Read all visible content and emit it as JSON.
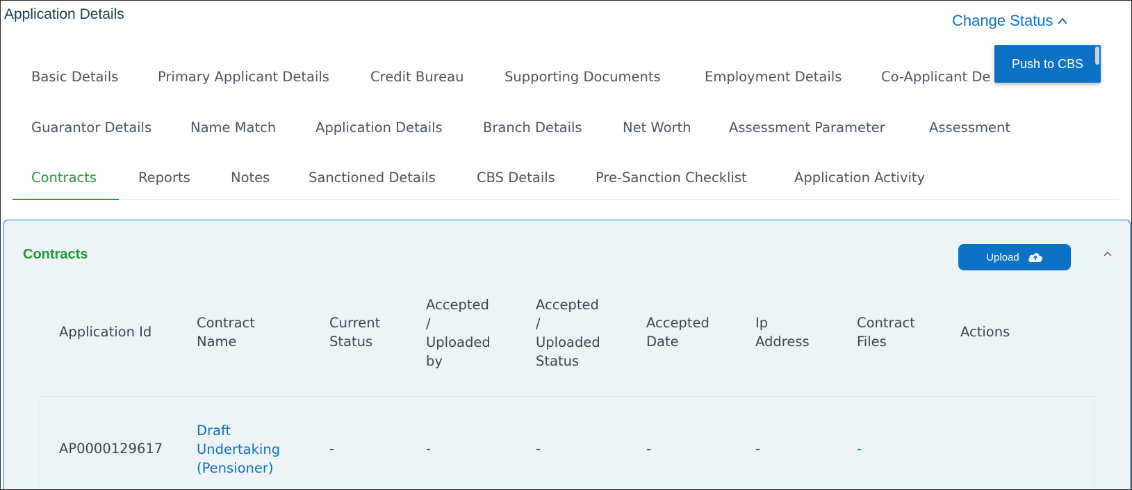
{
  "header": {
    "title": "Application Details",
    "change_status_label": "Change Status",
    "push_to_cbs_label": "Push to CBS"
  },
  "tabs": {
    "row1": [
      "Basic Details",
      "Primary Applicant Details",
      "Credit Bureau",
      "Supporting Documents",
      "Employment Details",
      "Co-Applicant De"
    ],
    "row2": [
      "Guarantor Details",
      "Name Match",
      "Application Details",
      "Branch Details",
      "Net Worth",
      "Assessment Parameter",
      "Assessment"
    ],
    "row3": [
      "Contracts",
      "Reports",
      "Notes",
      "Sanctioned Details",
      "CBS Details",
      "Pre-Sanction Checklist",
      "Application Activity"
    ],
    "active": "Contracts"
  },
  "contracts": {
    "title": "Contracts",
    "upload_label": "Upload",
    "columns": {
      "application_id": "Application Id",
      "contract_name_1": "Contract",
      "contract_name_2": "Name",
      "current_status_1": "Current",
      "current_status_2": "Status",
      "accepted_by_1": "Accepted",
      "accepted_by_2": "/",
      "accepted_by_3": "Uploaded",
      "accepted_by_4": "by",
      "accepted_status_1": "Accepted",
      "accepted_status_2": "/",
      "accepted_status_3": "Uploaded",
      "accepted_status_4": "Status",
      "accepted_date_1": "Accepted",
      "accepted_date_2": "Date",
      "ip_address_1": "Ip",
      "ip_address_2": "Address",
      "contract_files_1": "Contract",
      "contract_files_2": "Files",
      "actions": "Actions"
    },
    "rows": [
      {
        "application_id": "AP0000129617",
        "contract_name_1": "Draft",
        "contract_name_2": "Undertaking",
        "contract_name_3": "(Pensioner)",
        "current_status": "-",
        "accepted_by": "-",
        "accepted_status": "-",
        "accepted_date": "-",
        "ip_address": "-",
        "contract_files": "-"
      }
    ]
  },
  "colors": {
    "accent_blue": "#0b72c6",
    "active_green": "#1f9a3a",
    "panel_bg": "#eef3f6"
  }
}
